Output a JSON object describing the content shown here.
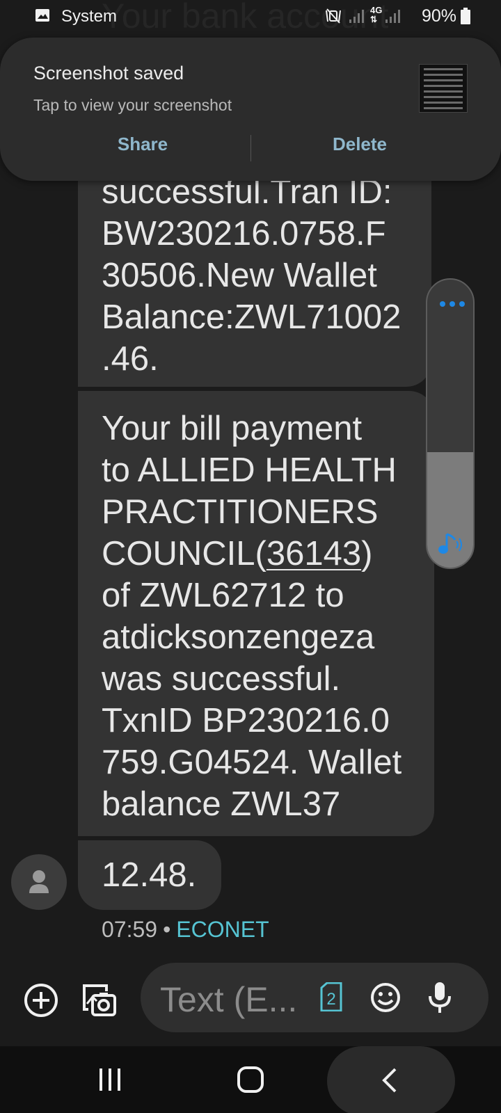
{
  "status_bar": {
    "app_name": "System",
    "network": "4G",
    "battery": "90%"
  },
  "background_text": "Your bank account",
  "notification": {
    "title": "Screenshot saved",
    "subtitle": "Tap to view your screenshot",
    "share_label": "Share",
    "delete_label": "Delete"
  },
  "messages": [
    {
      "lines": [
        "successful.Tran ID:",
        "BW230216.0758.F",
        "30506.New Wallet",
        "Balance:ZWL71002",
        ".46."
      ]
    },
    {
      "line1": "Your bill payment",
      "line2": "to ALLIED HEALTH",
      "line3": "PRACTITIONERS",
      "line4_prefix": "COUNCIL(",
      "line4_link": "36143",
      "line4_suffix": ")",
      "line5": "of ZWL62712 to",
      "line6": "atdicksonzengeza",
      "line7": "was successful.",
      "line8": "TxnID BP230216.0",
      "line9": "759.G04524. Wallet",
      "line10": "balance ZWL37"
    },
    {
      "lines": [
        "12.48."
      ]
    }
  ],
  "message_meta": {
    "time": "07:59",
    "separator": "•",
    "sender": "ECONET"
  },
  "volume": {
    "level": 0.4
  },
  "composer": {
    "placeholder": "Text (E...",
    "sim_number": "2"
  },
  "icons": {
    "status": [
      "gallery-icon",
      "mute-icon",
      "signal-icon",
      "battery-icon"
    ],
    "composer": [
      "add-icon",
      "gallery-camera-icon",
      "sim-icon",
      "emoji-icon",
      "mic-icon"
    ],
    "nav": [
      "recents-icon",
      "home-icon",
      "back-icon"
    ]
  },
  "colors": {
    "accent": "#56c4d3",
    "notification_button": "#8fb7cc",
    "bubble": "#333333",
    "background": "#1b1b1b",
    "volume_accent": "#1e88e5"
  }
}
